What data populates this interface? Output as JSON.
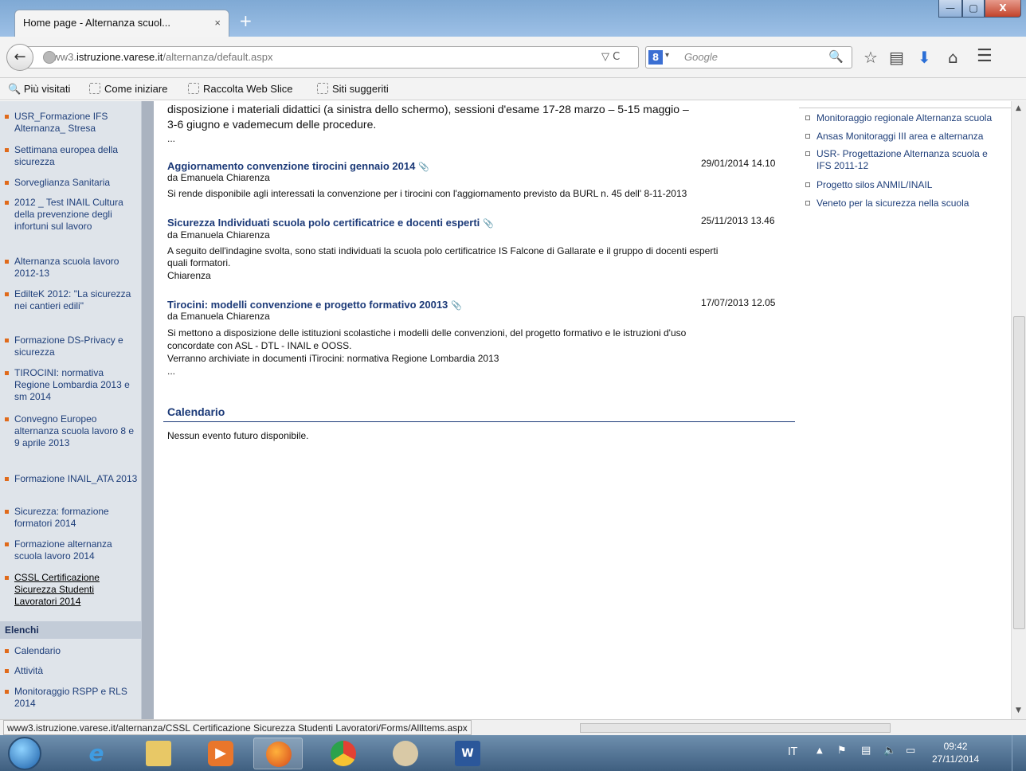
{
  "browser": {
    "tab_title": "Home page - Alternanza scuol...",
    "tab_close": "×",
    "new_tab": "+",
    "url_prefix": "www3.",
    "url_domain": "istruzione.varese.it",
    "url_path": "/alternanza/default.aspx",
    "url_controls": "▽ C",
    "search_placeholder": "Google",
    "search_engine_glyph": "8"
  },
  "window_controls": {
    "minimize": "—",
    "maximize": "▢",
    "close": "X"
  },
  "bookmarks": {
    "most_visited": "Più visitati",
    "items": [
      "Come iniziare",
      "Raccolta Web Slice",
      "Siti suggeriti"
    ]
  },
  "leftnav": {
    "items": [
      "USR_Formazione IFS Alternanza_ Stresa",
      "Settimana europea della sicurezza",
      "Sorveglianza Sanitaria",
      "2012 _ Test INAIL Cultura della prevenzione degli infortuni sul lavoro",
      "Alternanza scuola lavoro 2012-13",
      "EdilteK 2012: \"La sicurezza nei cantieri edili\"",
      "Formazione DS-Privacy e sicurezza",
      "TIROCINI: normativa Regione Lombardia 2013 e sm 2014",
      "Convegno Europeo alternanza scuola lavoro 8 e 9 aprile 2013",
      "Formazione INAIL_ATA 2013",
      "Sicurezza: formazione formatori 2014",
      "Formazione alternanza scuola lavoro 2014",
      "CSSL Certificazione Sicurezza Studenti Lavoratori 2014"
    ],
    "section_header": "Elenchi",
    "section_items": [
      "Calendario",
      "Attività",
      "Monitoraggio RSPP e RLS 2014"
    ]
  },
  "main": {
    "intro_line1": "disposizione i materiali didattici (a sinistra dello schermo), sessioni d'esame 17-28 marzo – 5-15 maggio –",
    "intro_line2": "3-6 giugno e vademecum delle procedure.",
    "intro_ellipsis": "...",
    "news": [
      {
        "title": "Aggiornamento convenzione tirocini gennaio 2014",
        "date": "29/01/2014 14.10",
        "author": "da Emanuela Chiarenza",
        "body": "Si rende disponibile agli interessati la convenzione per i tirocini con l'aggiornamento previsto da BURL n. 45 dell' 8-11-2013"
      },
      {
        "title": "Sicurezza Individuati scuola polo certificatrice e docenti esperti",
        "date": "25/11/2013 13.46",
        "author": "da Emanuela Chiarenza",
        "body_line1": "A seguito dell'indagine svolta, sono stati individuati la scuola polo certificatrice IS Falcone di Gallarate e il gruppo di docenti esperti",
        "body_line2": "quali formatori.",
        "body_line3": "Chiarenza"
      },
      {
        "title": "Tirocini: modelli convenzione e progetto formativo 20013",
        "date": "17/07/2013 12.05",
        "author": "da Emanuela Chiarenza",
        "body_line1": "Si mettono a disposizione delle istituzioni scolastiche i modelli delle convenzioni, del progetto formativo e le istruzioni d'uso",
        "body_line2": "concordate con ASL - DTL - INAIL e OOSS.",
        "body_line3": "Verranno archiviate in documenti iTirocini: normativa Regione Lombardia 2013",
        "body_line4": "..."
      }
    ],
    "calendar_title": "Calendario",
    "calendar_empty": "Nessun evento futuro disponibile."
  },
  "rightcol": {
    "links": [
      "Monitoraggio regionale Alternanza scuola",
      "Ansas Monitoraggi III area e alternanza",
      "USR- Progettazione Alternanza scuola e",
      "IFS 2011-12",
      "Progetto silos ANMIL/INAIL",
      "Veneto per la sicurezza nella scuola"
    ]
  },
  "statusbar": {
    "link_url": "www3.istruzione.varese.it/alternanza/CSSL Certificazione Sicurezza Studenti Lavoratori/Forms/AllItems.aspx"
  },
  "taskbar": {
    "language": "IT",
    "time": "09:42",
    "date": "27/11/2014"
  },
  "colors": {
    "link_blue": "#1c3a78",
    "nav_bullet": "#e06a1b",
    "sidebar_bg": "#dfe4ea"
  }
}
